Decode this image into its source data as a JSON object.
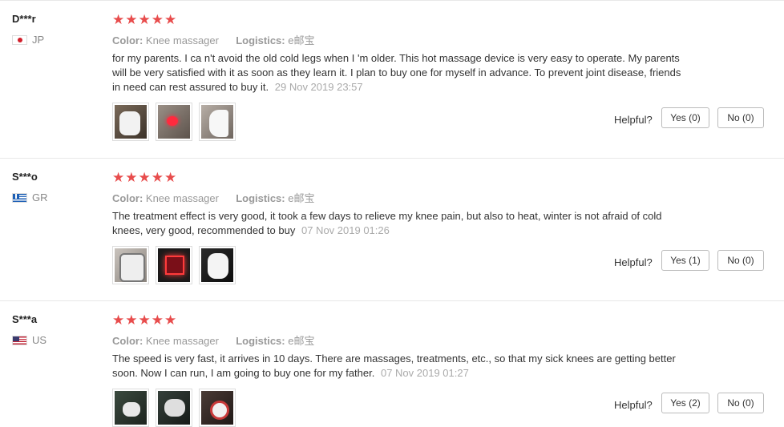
{
  "reviews": [
    {
      "user": "D***r",
      "country": "JP",
      "flag": "jp",
      "stars": "★★★★★",
      "rating": 5,
      "color_label": "Color:",
      "color_value": "Knee massager",
      "logistics_label": "Logistics:",
      "logistics_value": "e邮宝",
      "text": "for my parents. I ca n't avoid the old cold legs when I 'm older. This hot massage device is very easy to operate. My parents will be very satisfied with it as soon as they learn it. I plan to buy one for myself in advance. To prevent joint disease, friends in need can rest assured to buy it.",
      "date": "29 Nov 2019 23:57",
      "helpful_label": "Helpful?",
      "yes_label": "Yes (0)",
      "no_label": "No (0)",
      "photos": [
        "photo",
        "photo",
        "photo"
      ]
    },
    {
      "user": "S***o",
      "country": "GR",
      "flag": "gr",
      "stars": "★★★★★",
      "rating": 5,
      "color_label": "Color:",
      "color_value": "Knee massager",
      "logistics_label": "Logistics:",
      "logistics_value": "e邮宝",
      "text": "The treatment effect is very good, it took a few days to relieve my knee pain, but also to heat, winter is not afraid of cold knees, very good, recommended to buy",
      "date": "07 Nov 2019 01:26",
      "helpful_label": "Helpful?",
      "yes_label": "Yes (1)",
      "no_label": "No (0)",
      "photos": [
        "photo",
        "photo",
        "photo"
      ]
    },
    {
      "user": "S***a",
      "country": "US",
      "flag": "us",
      "stars": "★★★★★",
      "rating": 5,
      "color_label": "Color:",
      "color_value": "Knee massager",
      "logistics_label": "Logistics:",
      "logistics_value": "e邮宝",
      "text": "The speed is very fast, it arrives in 10 days. There are massages, treatments, etc., so that my sick knees are getting better soon. Now I can run, I am going to buy one for my father.",
      "date": "07 Nov 2019 01:27",
      "helpful_label": "Helpful?",
      "yes_label": "Yes (2)",
      "no_label": "No (0)",
      "photos": [
        "photo",
        "photo",
        "photo"
      ]
    }
  ],
  "colors": {
    "star": "#e84c4c",
    "muted": "#999999",
    "date": "#aaaaaa"
  }
}
